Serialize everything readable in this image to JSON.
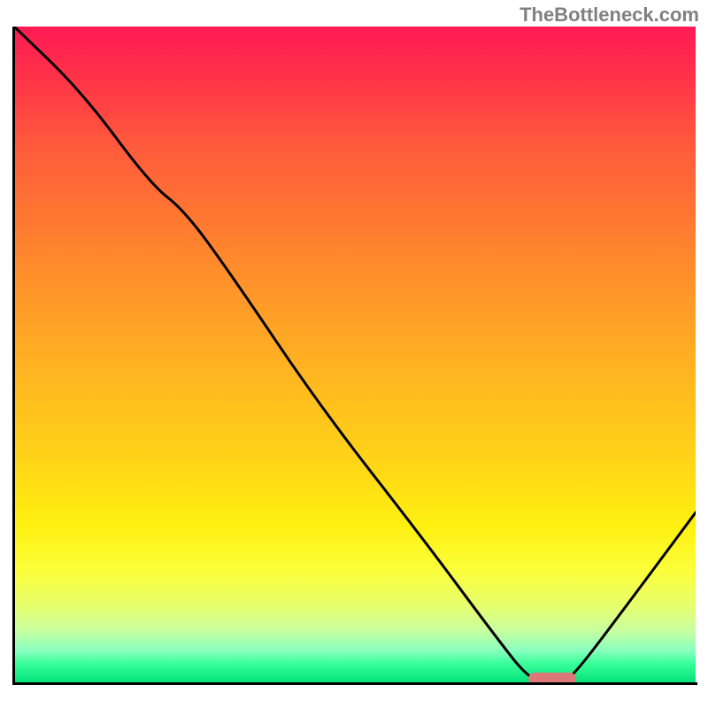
{
  "watermark": "TheBottleneck.com",
  "chart_data": {
    "type": "line",
    "title": "",
    "xlabel": "",
    "ylabel": "",
    "xlim": [
      0,
      100
    ],
    "ylim": [
      0,
      100
    ],
    "series": [
      {
        "name": "curve",
        "x": [
          0,
          10,
          20,
          25,
          32,
          45,
          60,
          70,
          76,
          80,
          82,
          90,
          100
        ],
        "values": [
          100,
          90,
          76,
          72,
          62,
          42,
          22,
          8,
          0,
          0,
          1,
          12,
          26
        ]
      }
    ],
    "marker": {
      "x_start": 76,
      "x_end": 82,
      "y": 0,
      "color": "#dd7878"
    },
    "gradient_stops": [
      {
        "pos": 0,
        "color": "#ff1a55"
      },
      {
        "pos": 8,
        "color": "#ff3348"
      },
      {
        "pos": 18,
        "color": "#ff5a3c"
      },
      {
        "pos": 30,
        "color": "#ff7a30"
      },
      {
        "pos": 42,
        "color": "#ff9a28"
      },
      {
        "pos": 54,
        "color": "#ffb820"
      },
      {
        "pos": 66,
        "color": "#ffd418"
      },
      {
        "pos": 76,
        "color": "#fff010"
      },
      {
        "pos": 83,
        "color": "#fbff3c"
      },
      {
        "pos": 88,
        "color": "#e8ff6c"
      },
      {
        "pos": 92,
        "color": "#c8ffa0"
      },
      {
        "pos": 95,
        "color": "#8affc0"
      },
      {
        "pos": 97,
        "color": "#3aff9a"
      },
      {
        "pos": 100,
        "color": "#00e078"
      }
    ]
  }
}
